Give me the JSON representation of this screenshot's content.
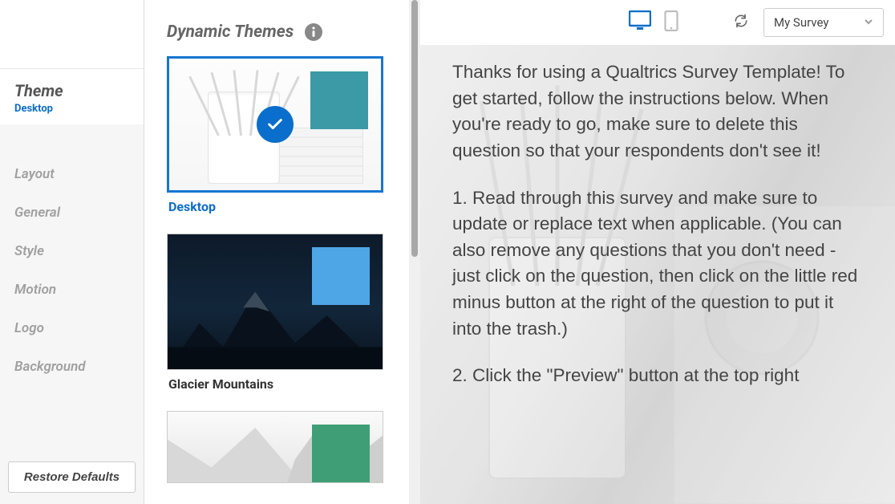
{
  "sidebar": {
    "active_title": "Theme",
    "active_subtitle": "Desktop",
    "items": [
      "Layout",
      "General",
      "Style",
      "Motion",
      "Logo",
      "Background"
    ],
    "restore_label": "Restore Defaults"
  },
  "theme_panel": {
    "title": "Dynamic Themes",
    "themes": [
      {
        "label": "Desktop",
        "selected": true,
        "swatch": "#3b9aa6"
      },
      {
        "label": "Glacier Mountains",
        "selected": false,
        "swatch": "#4fa6e6"
      },
      {
        "label": "",
        "selected": false,
        "swatch": "#3f9e76"
      }
    ]
  },
  "preview": {
    "survey_selected": "My Survey",
    "paragraphs": [
      "Thanks for using a Qualtrics Survey Template! To get started, follow the instructions below. When you're ready to go, make sure to delete this question so that your respondents don't see it!",
      "1. Read through this survey and make sure to update or replace text when applicable. (You can also remove any questions that you don't need - just click on the question, then click on the little red minus button at the right of the question to put it into the trash.)",
      "2. Click the \"Preview\" button at the top right"
    ]
  }
}
